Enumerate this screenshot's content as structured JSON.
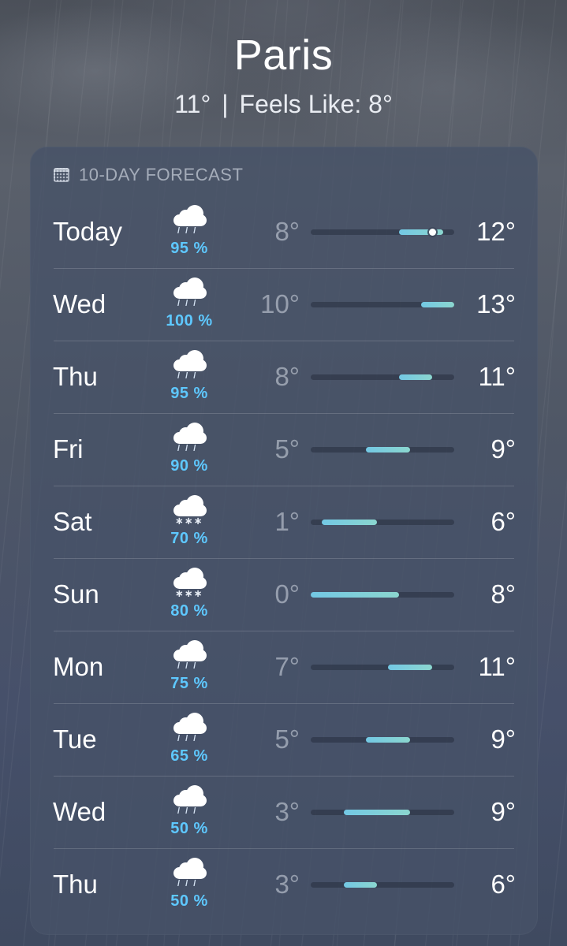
{
  "header": {
    "city": "Paris",
    "current_temp": "11°",
    "separator": "|",
    "feels_like": "Feels Like: 8°"
  },
  "forecast": {
    "title": "10-DAY FORECAST",
    "title_icon": "calendar-icon",
    "range_min": 0,
    "range_max": 13,
    "current_temp_value": 11,
    "days": [
      {
        "day": "Today",
        "icon": "rain-cloud-icon",
        "precip": "95 %",
        "low": "8°",
        "high": "12°",
        "low_value": 8,
        "high_value": 12
      },
      {
        "day": "Wed",
        "icon": "rain-cloud-icon",
        "precip": "100 %",
        "low": "10°",
        "high": "13°",
        "low_value": 10,
        "high_value": 13
      },
      {
        "day": "Thu",
        "icon": "rain-cloud-icon",
        "precip": "95 %",
        "low": "8°",
        "high": "11°",
        "low_value": 8,
        "high_value": 11
      },
      {
        "day": "Fri",
        "icon": "rain-cloud-icon",
        "precip": "90 %",
        "low": "5°",
        "high": "9°",
        "low_value": 5,
        "high_value": 9
      },
      {
        "day": "Sat",
        "icon": "snow-cloud-icon",
        "precip": "70 %",
        "low": "1°",
        "high": "6°",
        "low_value": 1,
        "high_value": 6
      },
      {
        "day": "Sun",
        "icon": "snow-cloud-icon",
        "precip": "80 %",
        "low": "0°",
        "high": "8°",
        "low_value": 0,
        "high_value": 8
      },
      {
        "day": "Mon",
        "icon": "rain-cloud-icon",
        "precip": "75 %",
        "low": "7°",
        "high": "11°",
        "low_value": 7,
        "high_value": 11
      },
      {
        "day": "Tue",
        "icon": "rain-cloud-icon",
        "precip": "65 %",
        "low": "5°",
        "high": "9°",
        "low_value": 5,
        "high_value": 9
      },
      {
        "day": "Wed",
        "icon": "rain-cloud-icon",
        "precip": "50 %",
        "low": "3°",
        "high": "9°",
        "low_value": 3,
        "high_value": 9
      },
      {
        "day": "Thu",
        "icon": "rain-cloud-icon",
        "precip": "50 %",
        "low": "3°",
        "high": "6°",
        "low_value": 3,
        "high_value": 6
      }
    ]
  },
  "colors": {
    "precip_text": "#5ec8ff",
    "bar_start": "#73c8e4",
    "bar_end": "#8bd6cf"
  }
}
